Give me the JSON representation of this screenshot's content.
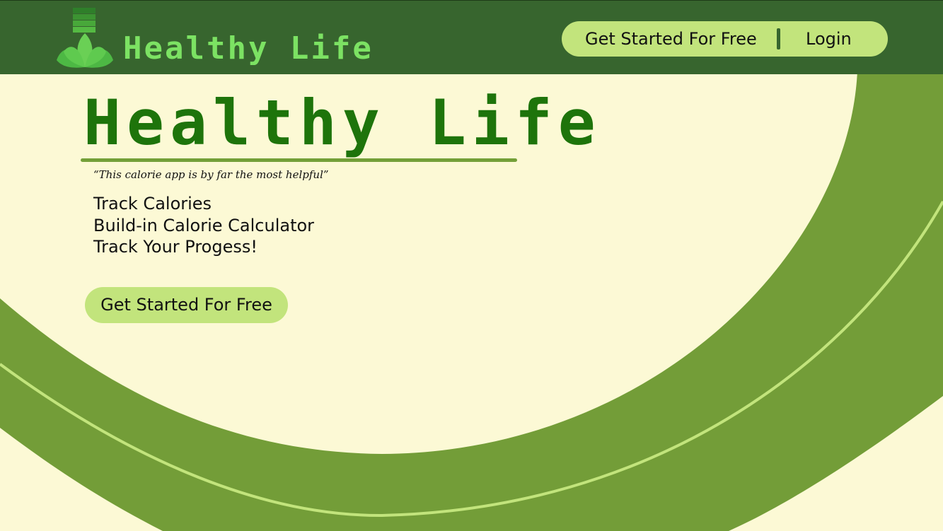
{
  "header": {
    "brand_name": "Healthy Life",
    "nav": {
      "get_started_label": "Get Started For Free",
      "login_label": "Login"
    }
  },
  "hero": {
    "title": "Healthy Life",
    "quote": "“This calorie app is by far the most helpful”",
    "features": [
      "Track Calories",
      "Build-in Calorie Calculator",
      "Track Your Progess!"
    ],
    "cta_label": "Get Started For Free"
  },
  "icons": {
    "logo": "lotus-logo-icon"
  },
  "colors": {
    "header_bg": "#37652E",
    "brand_text": "#7CE263",
    "page_bg": "#FCF9D5",
    "hero_title": "#1E740B",
    "arc_band": "#739D38",
    "accent_button": "#C2E47C",
    "arc_line": "#C2E47C"
  }
}
